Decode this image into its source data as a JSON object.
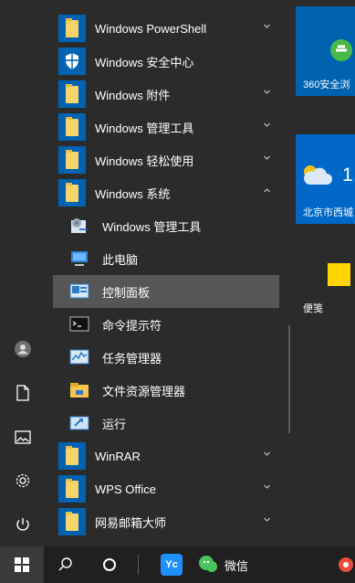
{
  "rail": {
    "items": [
      {
        "name": "user-avatar-icon"
      },
      {
        "name": "document-icon"
      },
      {
        "name": "pictures-icon"
      },
      {
        "name": "settings-icon"
      },
      {
        "name": "power-icon"
      }
    ]
  },
  "menu": {
    "items": [
      {
        "label": "Windows PowerShell",
        "icon": "folder-icon",
        "chevron": "down"
      },
      {
        "label": "Windows 安全中心",
        "icon": "shield-icon"
      },
      {
        "label": "Windows 附件",
        "icon": "folder-icon",
        "chevron": "down"
      },
      {
        "label": "Windows 管理工具",
        "icon": "folder-icon",
        "chevron": "down"
      },
      {
        "label": "Windows 轻松使用",
        "icon": "folder-icon",
        "chevron": "down"
      },
      {
        "label": "Windows 系统",
        "icon": "folder-open-icon",
        "chevron": "up"
      },
      {
        "label": "Windows 管理工具",
        "icon": "admin-tools-icon",
        "sub": true
      },
      {
        "label": "此电脑",
        "icon": "this-pc-icon",
        "sub": true
      },
      {
        "label": "控制面板",
        "icon": "control-panel-icon",
        "sub": true,
        "selected": true
      },
      {
        "label": "命令提示符",
        "icon": "command-prompt-icon",
        "sub": true
      },
      {
        "label": "任务管理器",
        "icon": "task-manager-icon",
        "sub": true
      },
      {
        "label": "文件资源管理器",
        "icon": "file-explorer-icon",
        "sub": true
      },
      {
        "label": "运行",
        "icon": "run-icon",
        "sub": true
      },
      {
        "label": "WinRAR",
        "icon": "folder-icon",
        "chevron": "down"
      },
      {
        "label": "WPS Office",
        "icon": "folder-icon",
        "chevron": "down"
      },
      {
        "label": "网易邮箱大师",
        "icon": "folder-icon",
        "chevron": "down"
      }
    ]
  },
  "tiles": {
    "browser360": {
      "label": "360安全浏"
    },
    "weather": {
      "temp": "1",
      "location": "北京市西城"
    },
    "sticky": {
      "label": "便笺"
    }
  },
  "taskbar": {
    "wechat_label": "微信"
  },
  "colors": {
    "accent": "#0063b1",
    "background": "#2b2b2b",
    "selected": "#565656",
    "taskbar": "#202020"
  }
}
